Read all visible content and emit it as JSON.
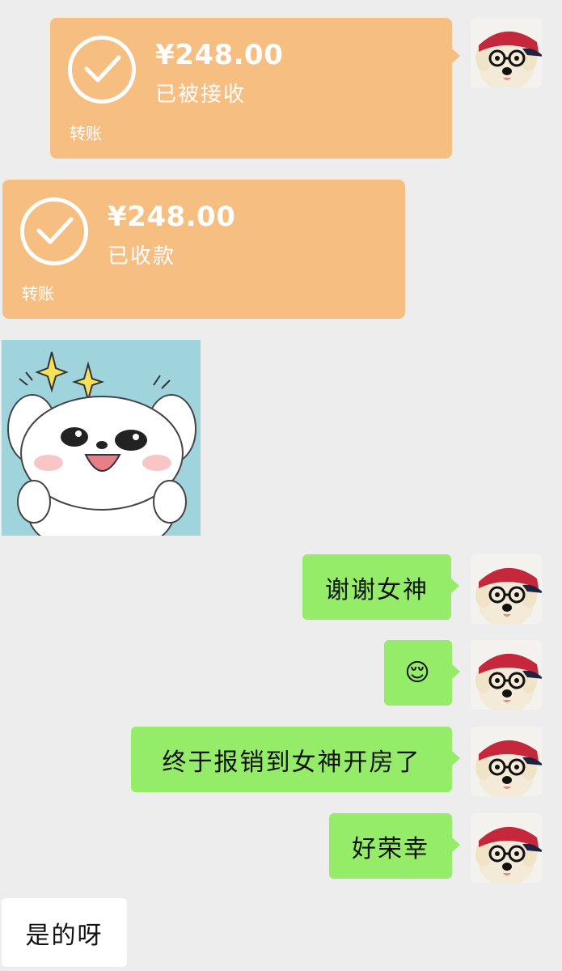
{
  "messages": {
    "transfer_out": {
      "amount": "¥248.00",
      "status": "已被接收",
      "kind": "转账"
    },
    "transfer_in": {
      "amount": "¥248.00",
      "status": "已收款",
      "kind": "转账"
    },
    "sticker": {
      "icon": "puppy-sticker"
    },
    "thanks": "谢谢女神",
    "emoji": "😌",
    "reimbursed": "终于报销到女神开房了",
    "honored": "好荣幸",
    "reply": "是的呀"
  },
  "colors": {
    "background": "#ededed",
    "transfer": "#f7be82",
    "sent_bubble": "#95ec69",
    "received_bubble": "#ffffff"
  },
  "avatar": {
    "icon": "dog-with-red-cap-avatar"
  }
}
